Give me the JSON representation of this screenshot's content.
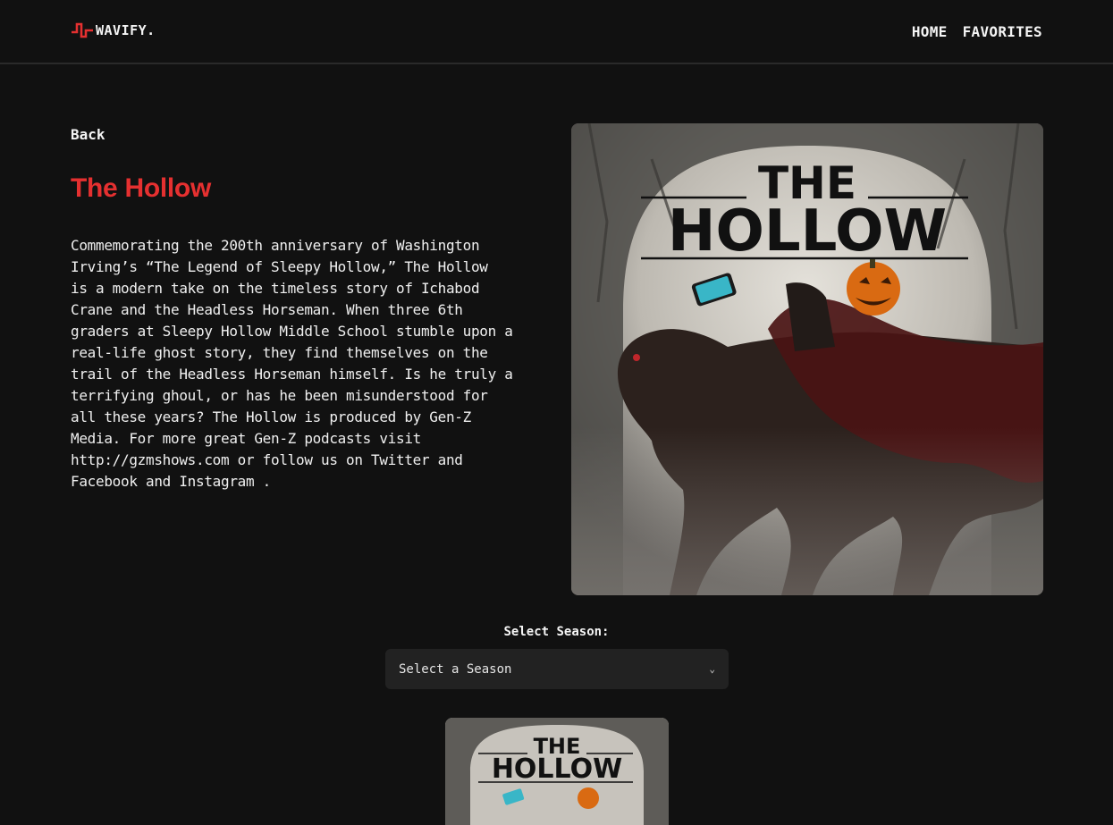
{
  "header": {
    "logo_text": "WAVIFY.",
    "logo_icon": "wave-icon",
    "nav": [
      {
        "label": "HOME"
      },
      {
        "label": "FAVORITES"
      }
    ]
  },
  "podcast": {
    "back_label": "Back",
    "title": "The Hollow",
    "description": "Commemorating the 200th anniversary of Washington\nIrving’s “The Legend of Sleepy Hollow,”  The Hollow\n is a modern take on the timeless story of Ichabod\nCrane and the Headless Horseman. When three 6th\ngraders at Sleepy Hollow Middle School stumble upon a\nreal-life ghost story, they find themselves on the\ntrail of the Headless Horseman himself. Is he truly a\nterrifying ghoul, or has he been misunderstood for\nall these years? The Hollow is produced by Gen-Z\nMedia. For more great Gen-Z podcasts visit\nhttp://gzmshows.com or follow us on Twitter and\nFacebook and Instagram .",
    "cover": {
      "line1": "THE",
      "line2": "HOLLOW"
    }
  },
  "season": {
    "label": "Select Season:",
    "selected": "Select a Season"
  },
  "colors": {
    "accent": "#e53030",
    "background": "#111111",
    "select_bg": "#222222"
  }
}
